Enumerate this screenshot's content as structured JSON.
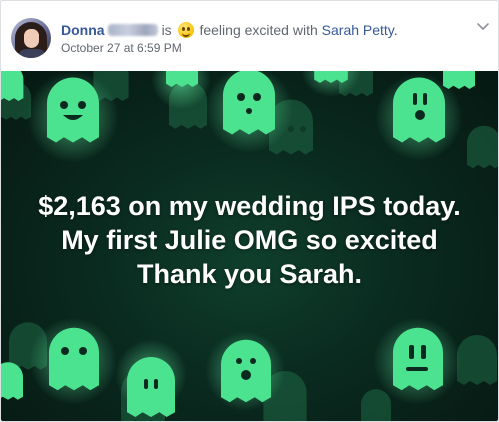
{
  "post": {
    "author_first": "Donna",
    "author_last_redacted": "Benjgra",
    "verb_is": "is",
    "emoji": "smiling-face-emoji",
    "feeling": "feeling excited with",
    "tagged": "Sarah Petty.",
    "timestamp": "October 27 at 6:59 PM",
    "image_caption": "$2,163 on my wedding IPS today. My first Julie OMG so excited Thank you Sarah."
  },
  "colors": {
    "link": "#365899",
    "meta": "#616770",
    "image_bg": "#0a2a1f",
    "ghost": "#4be38f"
  }
}
